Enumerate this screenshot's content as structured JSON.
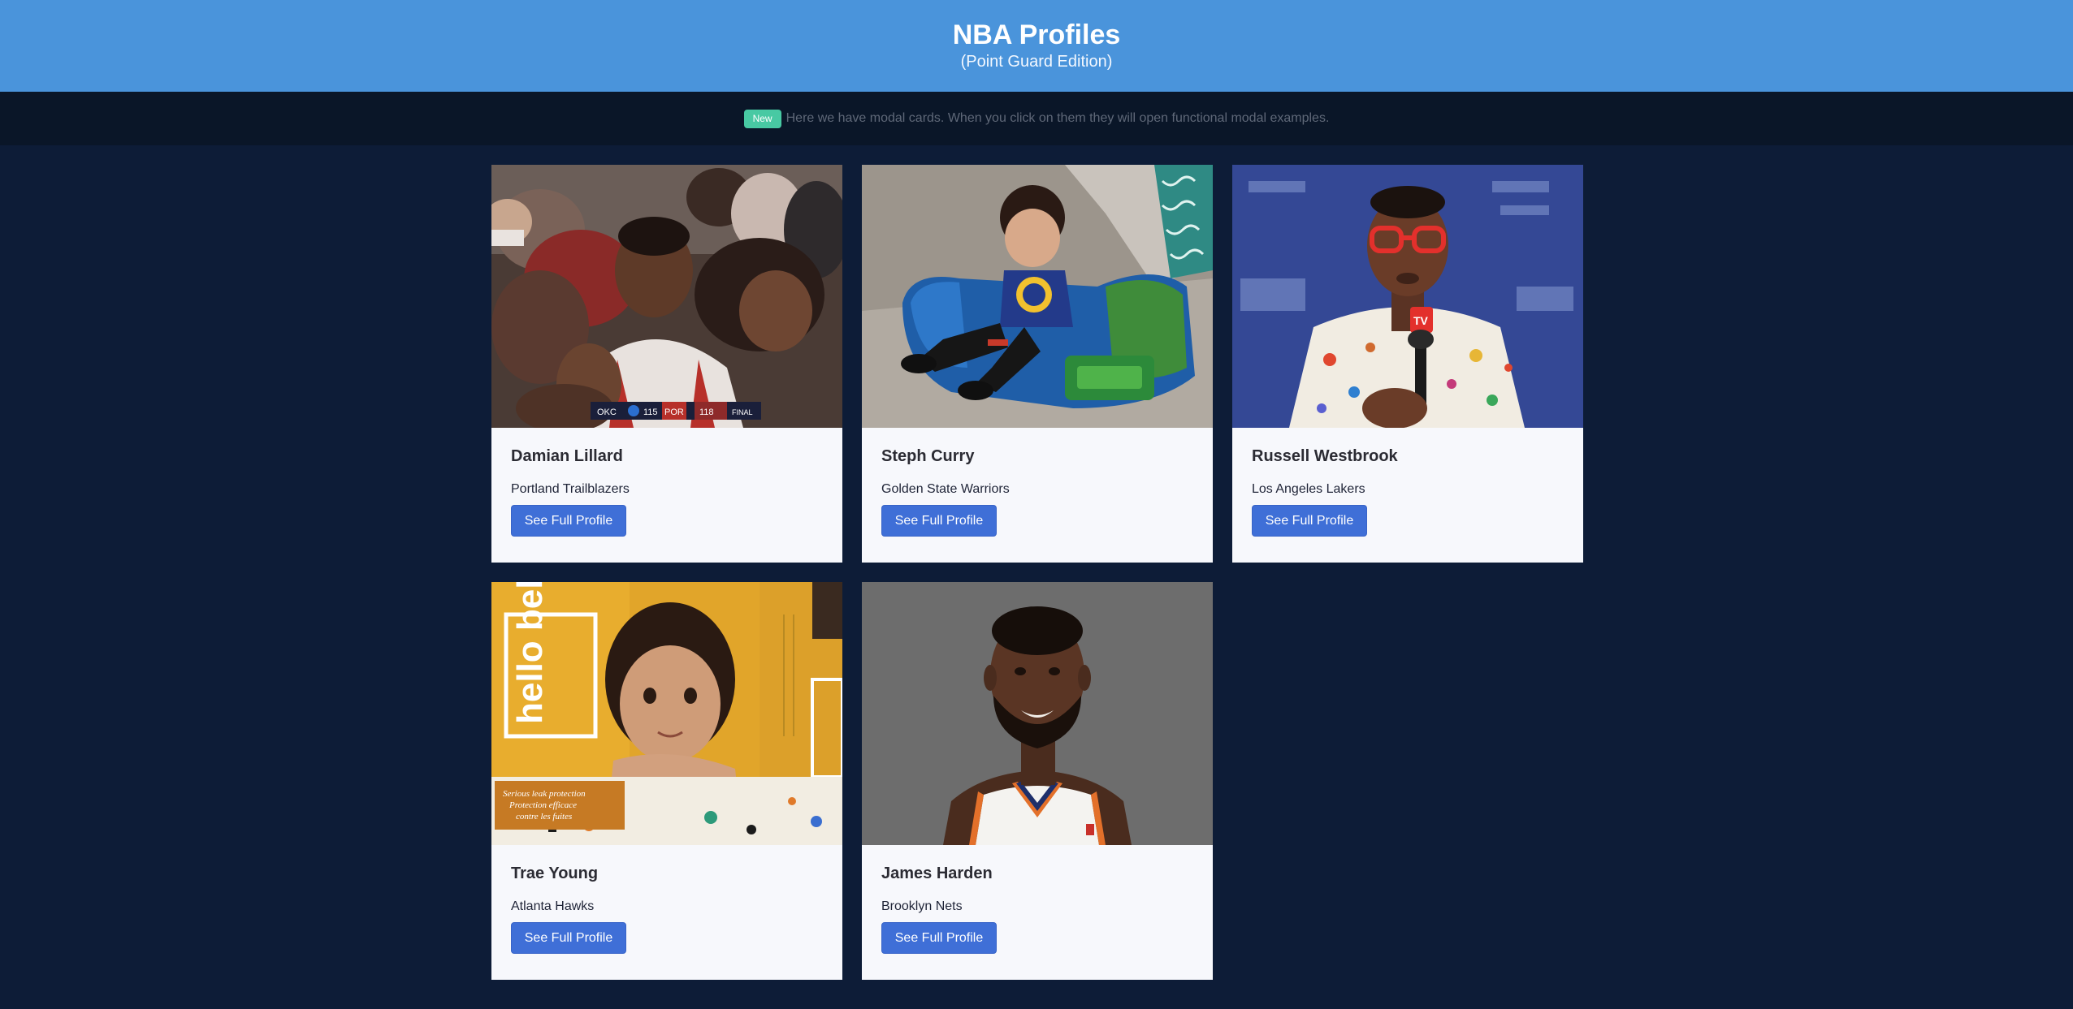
{
  "hero": {
    "title": "NBA Profiles",
    "subtitle": "(Point Guard Edition)",
    "background_color": "#4a94db"
  },
  "notice": {
    "tag": "New",
    "tag_color": "#48c9a3",
    "text": "Here we have modal cards. When you click on them they will open functional modal examples."
  },
  "page_background": "#0d1c37",
  "cards": [
    {
      "name": "Damian Lillard",
      "team": "Portland Trailblazers",
      "button_label": "See Full Profile",
      "image_icon": "player-celebration-photo"
    },
    {
      "name": "Steph Curry",
      "team": "Golden State Warriors",
      "button_label": "See Full Profile",
      "image_icon": "baby-on-couch-photo"
    },
    {
      "name": "Russell Westbrook",
      "team": "Los Angeles Lakers",
      "button_label": "See Full Profile",
      "image_icon": "press-conference-photo"
    },
    {
      "name": "Trae Young",
      "team": "Atlanta Hawks",
      "button_label": "See Full Profile",
      "image_icon": "baby-diaper-box-photo"
    },
    {
      "name": "James Harden",
      "team": "Brooklyn Nets",
      "button_label": "See Full Profile",
      "image_icon": "player-headshot-photo"
    }
  ],
  "photo_scoreboard": {
    "team_a": "OKC",
    "score_a": "115",
    "team_b": "POR",
    "score_b": "118",
    "status": "FINAL"
  },
  "photo_box_text": {
    "brand": "hello bello",
    "banner_line1": "Serious leak protection",
    "banner_line2": "Protection efficace",
    "banner_line3": "contre les fuites"
  },
  "photo_mic_label": "TV"
}
